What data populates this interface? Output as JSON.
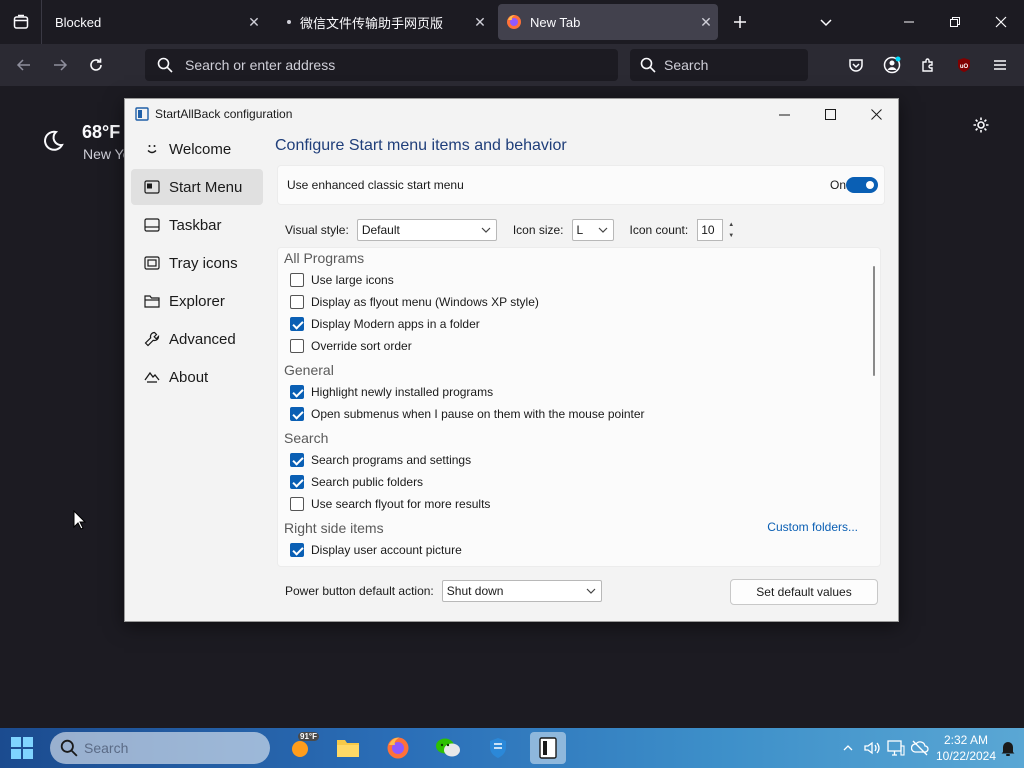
{
  "browser": {
    "tabs": [
      {
        "label": "Blocked"
      },
      {
        "label": "微信文件传输助手网页版"
      },
      {
        "label": "New Tab"
      }
    ],
    "address_placeholder": "Search or enter address",
    "search_placeholder": "Search"
  },
  "weather": {
    "temperature": "68°F",
    "location": "New Yo"
  },
  "dialog": {
    "title": "StartAllBack configuration",
    "nav": [
      {
        "label": "Welcome"
      },
      {
        "label": "Start Menu"
      },
      {
        "label": "Taskbar"
      },
      {
        "label": "Tray icons"
      },
      {
        "label": "Explorer"
      },
      {
        "label": "Advanced"
      },
      {
        "label": "About"
      }
    ],
    "heading": "Configure Start menu items and behavior",
    "enhanced": {
      "label": "Use enhanced classic start menu",
      "state": "On"
    },
    "visual_style": {
      "label": "Visual style:",
      "value": "Default"
    },
    "icon_size": {
      "label": "Icon size:",
      "value": "L"
    },
    "icon_count": {
      "label": "Icon count:",
      "value": "10"
    },
    "groups": [
      {
        "title": "All Programs",
        "items": [
          {
            "label": "Use large icons",
            "checked": false
          },
          {
            "label": "Display as flyout menu (Windows XP style)",
            "checked": false
          },
          {
            "label": "Display Modern apps in a folder",
            "checked": true
          },
          {
            "label": "Override sort order",
            "checked": false
          }
        ]
      },
      {
        "title": "General",
        "items": [
          {
            "label": "Highlight newly installed programs",
            "checked": true
          },
          {
            "label": "Open submenus when I pause on them with the mouse pointer",
            "checked": true
          }
        ]
      },
      {
        "title": "Search",
        "items": [
          {
            "label": "Search programs and settings",
            "checked": true
          },
          {
            "label": "Search public folders",
            "checked": true
          },
          {
            "label": "Use search flyout for more results",
            "checked": false
          }
        ]
      },
      {
        "title": "Right side items",
        "items": [
          {
            "label": "Display user account picture",
            "checked": true
          }
        ]
      }
    ],
    "custom_folders_link": "Custom folders...",
    "power_action": {
      "label": "Power button default action:",
      "value": "Shut down"
    },
    "default_button": "Set default values"
  },
  "taskbar": {
    "search_placeholder": "Search",
    "weather_badge": "91°F",
    "clock_time": "2:32 AM",
    "clock_date": "10/22/2024"
  }
}
